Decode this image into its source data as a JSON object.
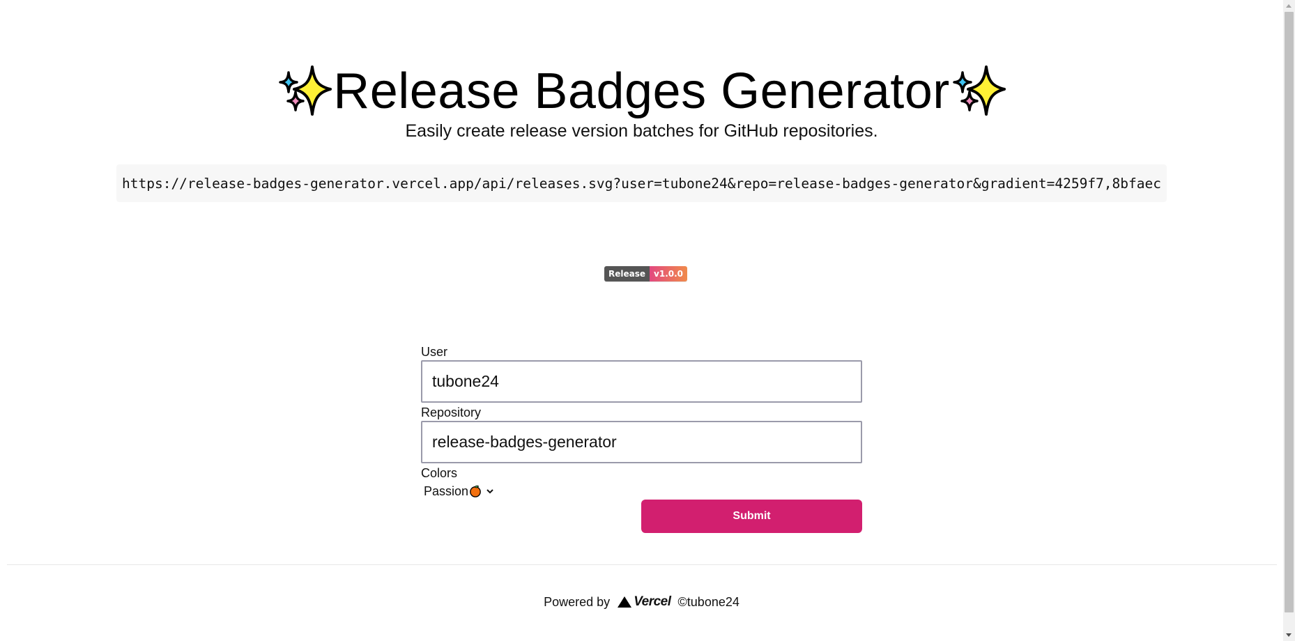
{
  "header": {
    "title": "Release Badges Generator",
    "subtitle": "Easily create release version batches for GitHub repositories.",
    "left_icon": "sparkles-icon",
    "right_icon": "sparkles-icon"
  },
  "url": "https://release-badges-generator.vercel.app/api/releases.svg?user=tubone24&repo=release-badges-generator&gradient=4259f7,8bfaec",
  "badge": {
    "label": "Release",
    "value": "v1.0.0",
    "label_color": "#555555",
    "gradient_start": "#e2497f",
    "gradient_end": "#f08a4b"
  },
  "form": {
    "user_label": "User",
    "user_value": "tubone24",
    "repo_label": "Repository",
    "repo_value": "release-badges-generator",
    "colors_label": "Colors",
    "colors_selected": "Passion",
    "colors_icon": "orange-icon",
    "submit_label": "Submit",
    "accent": "#d21f6f"
  },
  "footer": {
    "powered_by": "Powered by",
    "vercel": "Vercel",
    "copyright": "©tubone24"
  }
}
